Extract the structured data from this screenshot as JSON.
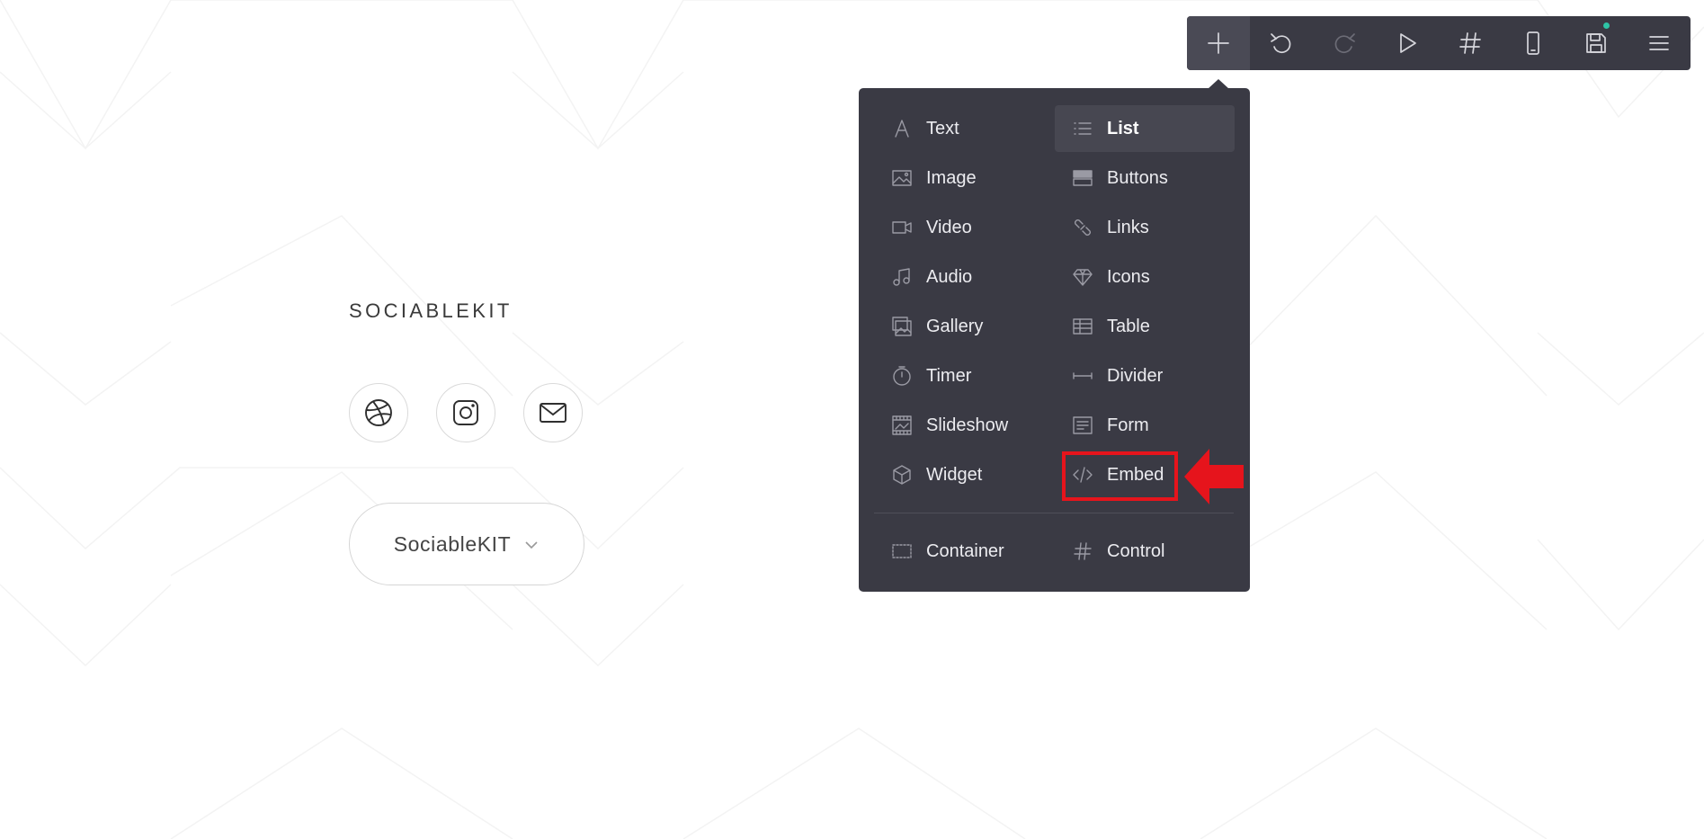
{
  "page": {
    "brand": "SOCIABLEKIT",
    "social_icons": [
      "dribbble-icon",
      "instagram-icon",
      "mail-icon"
    ],
    "dropdown_label": "SociableKIT"
  },
  "toolbar": {
    "buttons": [
      "add-icon",
      "undo-icon",
      "redo-icon",
      "preview-icon",
      "hash-icon",
      "mobile-icon",
      "save-icon",
      "menu-icon"
    ],
    "active": "add-icon",
    "disabled": [
      "redo-icon"
    ],
    "save_indicator_color": "#2ec4a6"
  },
  "add_panel": {
    "left_column": [
      {
        "label": "Text",
        "icon": "text-icon"
      },
      {
        "label": "Image",
        "icon": "image-icon"
      },
      {
        "label": "Video",
        "icon": "video-icon"
      },
      {
        "label": "Audio",
        "icon": "audio-icon"
      },
      {
        "label": "Gallery",
        "icon": "gallery-icon"
      },
      {
        "label": "Timer",
        "icon": "timer-icon"
      },
      {
        "label": "Slideshow",
        "icon": "slideshow-icon"
      },
      {
        "label": "Widget",
        "icon": "widget-icon"
      }
    ],
    "right_column": [
      {
        "label": "List",
        "icon": "list-icon",
        "highlighted": true
      },
      {
        "label": "Buttons",
        "icon": "buttons-icon"
      },
      {
        "label": "Links",
        "icon": "links-icon"
      },
      {
        "label": "Icons",
        "icon": "diamond-icon"
      },
      {
        "label": "Table",
        "icon": "table-icon"
      },
      {
        "label": "Divider",
        "icon": "divider-icon"
      },
      {
        "label": "Form",
        "icon": "form-icon"
      },
      {
        "label": "Embed",
        "icon": "embed-icon",
        "annotated": true
      }
    ],
    "footer": [
      {
        "label": "Container",
        "icon": "container-icon"
      },
      {
        "label": "Control",
        "icon": "control-icon"
      }
    ]
  },
  "colors": {
    "panel_bg": "#3a3a44",
    "annotation": "#e6141c"
  }
}
